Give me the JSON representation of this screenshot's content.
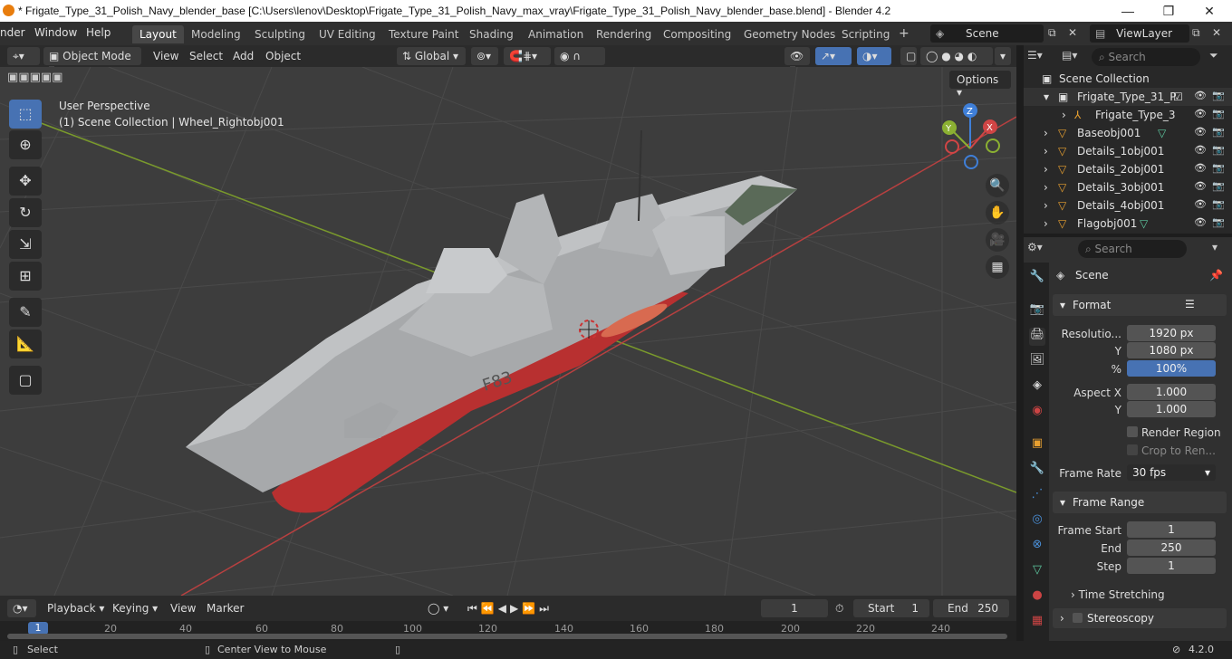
{
  "window": {
    "title": "* Frigate_Type_31_Polish_Navy_blender_base [C:\\Users\\lenov\\Desktop\\Frigate_Type_31_Polish_Navy_max_vray\\Frigate_Type_31_Polish_Navy_blender_base.blend] - Blender 4.2",
    "minimize": "—",
    "maximize": "❐",
    "close": "✕"
  },
  "menubar": {
    "items": [
      "nder",
      "Window",
      "Help"
    ],
    "workspaces": [
      "Layout",
      "Modeling",
      "Sculpting",
      "UV Editing",
      "Texture Paint",
      "Shading",
      "Animation",
      "Rendering",
      "Compositing",
      "Geometry Nodes",
      "Scripting"
    ],
    "active_workspace": "Layout",
    "add_workspace": "+",
    "scene": "Scene",
    "view_layer": "ViewLayer"
  },
  "viewport_header": {
    "mode": "Object Mode",
    "menus": [
      "View",
      "Select",
      "Add",
      "Object"
    ],
    "orientation": "Global",
    "options": "Options"
  },
  "viewport": {
    "perspective_label": "User Perspective",
    "collection_label": "(1) Scene Collection | Wheel_Rightobj001",
    "hull_marking": "F83",
    "gizmo": {
      "x": "X",
      "y": "Y",
      "z": "Z"
    },
    "colors": {
      "bg": "#3d3d3d",
      "x_axis": "#d04545",
      "y_axis": "#8bb032",
      "z_axis": "#3f7fd8"
    }
  },
  "outliner": {
    "search_placeholder": "Search",
    "root": "Scene Collection",
    "rows": [
      {
        "label": "Frigate_Type_31_P",
        "icon": "collection-icon"
      },
      {
        "label": "Frigate_Type_3",
        "icon": "armature-icon"
      },
      {
        "label": "Baseobj001",
        "icon": "mesh-icon"
      },
      {
        "label": "Details_1obj001",
        "icon": "mesh-icon"
      },
      {
        "label": "Details_2obj001",
        "icon": "mesh-icon"
      },
      {
        "label": "Details_3obj001",
        "icon": "mesh-icon"
      },
      {
        "label": "Details_4obj001",
        "icon": "mesh-icon"
      },
      {
        "label": "Flagobj001",
        "icon": "mesh-icon"
      }
    ]
  },
  "properties": {
    "search_placeholder": "Search",
    "context": "Scene",
    "format": {
      "header": "Format",
      "resolution_x_label": "Resolutio...",
      "resolution_x": "1920 px",
      "resolution_y_label": "Y",
      "resolution_y": "1080 px",
      "percent_label": "%",
      "percent": "100%",
      "aspect_x_label": "Aspect X",
      "aspect_x": "1.000",
      "aspect_y_label": "Y",
      "aspect_y": "1.000",
      "render_region": "Render Region",
      "crop": "Crop to Ren...",
      "frame_rate_label": "Frame Rate",
      "frame_rate": "30 fps"
    },
    "frame_range": {
      "header": "Frame Range",
      "start_label": "Frame Start",
      "start": "1",
      "end_label": "End",
      "end": "250",
      "step_label": "Step",
      "step": "1",
      "time_stretching": "Time Stretching",
      "stereoscopy": "Stereoscopy"
    }
  },
  "timeline": {
    "menus": [
      "Playback",
      "Keying",
      "View",
      "Marker"
    ],
    "current_frame": "1",
    "start_label": "Start",
    "start": "1",
    "end_label": "End",
    "end": "250",
    "ticks": [
      "1",
      "20",
      "40",
      "60",
      "80",
      "100",
      "120",
      "140",
      "160",
      "180",
      "200",
      "220",
      "240"
    ]
  },
  "statusbar": {
    "select": "Select",
    "center": "Center View to Mouse",
    "version": "4.2.0"
  }
}
